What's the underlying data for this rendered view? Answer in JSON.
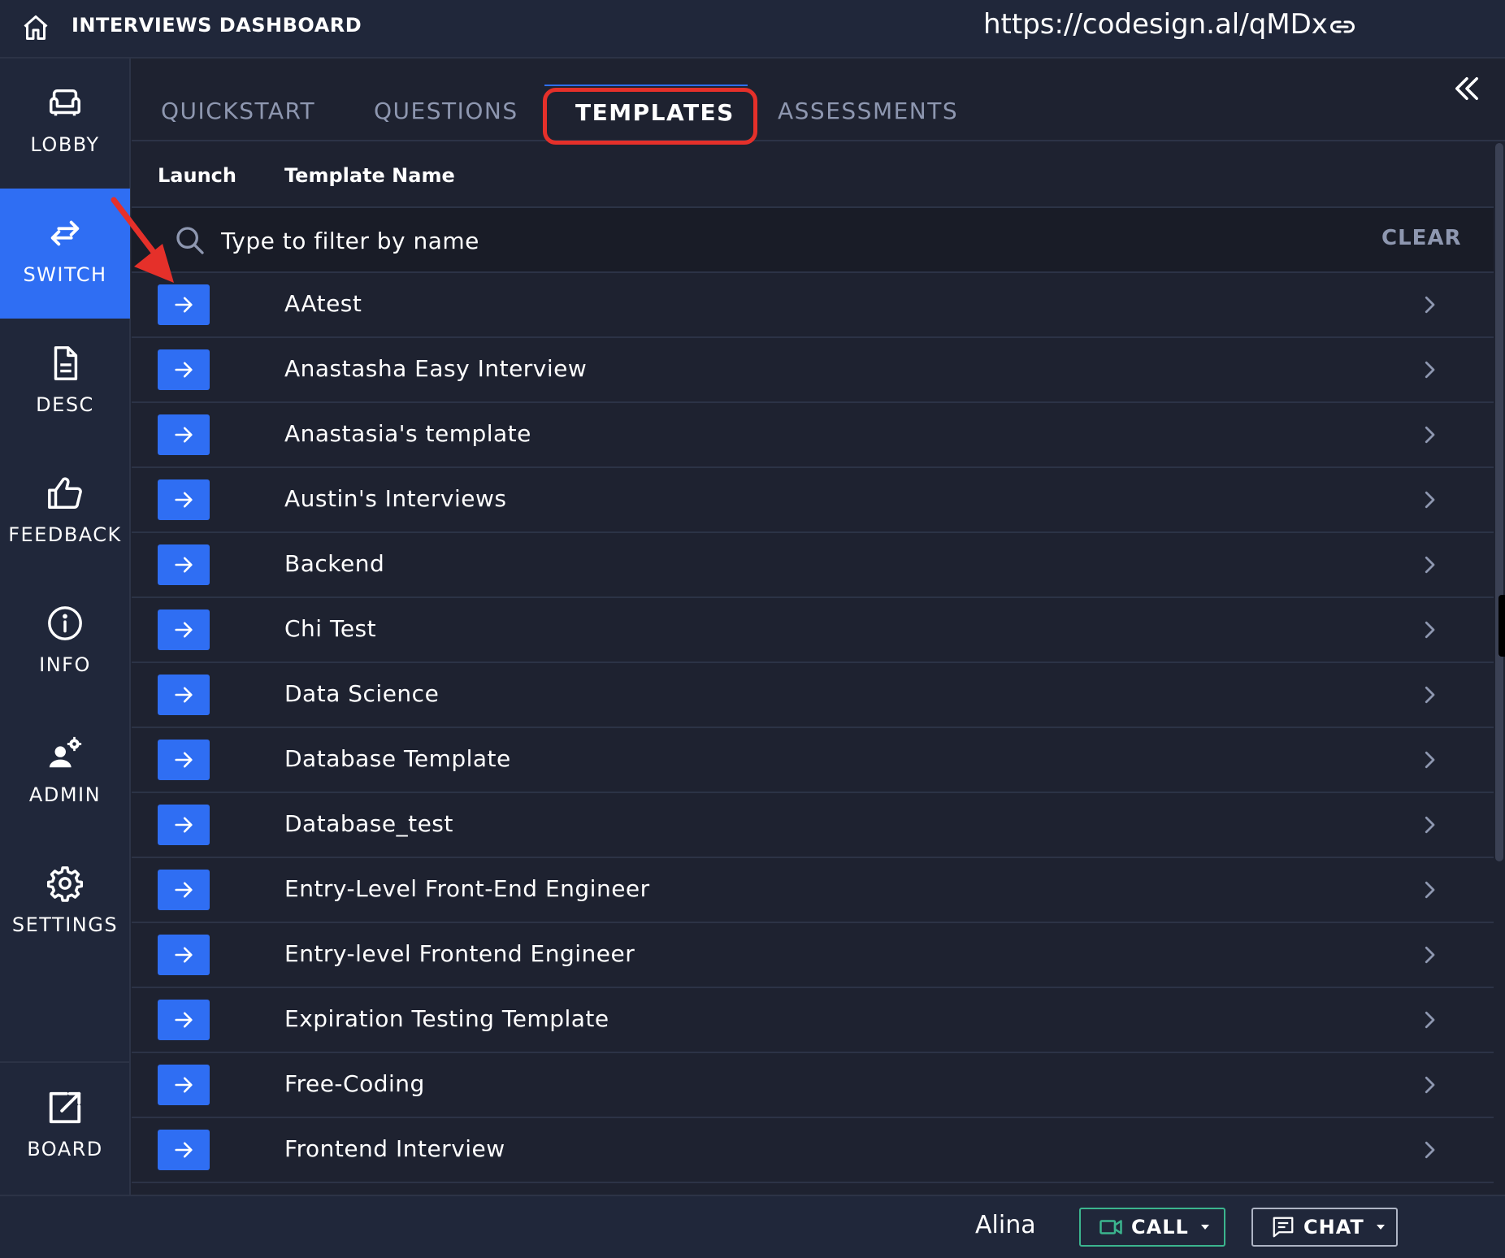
{
  "header": {
    "title": "INTERVIEWS DASHBOARD",
    "url": "https://codesign.al/qMDx"
  },
  "sidebar": {
    "items": [
      {
        "label": "LOBBY",
        "icon": "sofa-icon",
        "active": false
      },
      {
        "label": "SWITCH",
        "icon": "switch-arrows-icon",
        "active": true
      },
      {
        "label": "DESC",
        "icon": "document-icon",
        "active": false
      },
      {
        "label": "FEEDBACK",
        "icon": "thumbs-up-icon",
        "active": false
      },
      {
        "label": "INFO",
        "icon": "info-icon",
        "active": false
      },
      {
        "label": "ADMIN",
        "icon": "user-gear-icon",
        "active": false
      },
      {
        "label": "SETTINGS",
        "icon": "gear-icon",
        "active": false
      }
    ],
    "board": {
      "label": "BOARD",
      "icon": "external-link-icon"
    }
  },
  "tabs": [
    {
      "label": "QUICKSTART",
      "active": false
    },
    {
      "label": "QUESTIONS",
      "active": false
    },
    {
      "label": "TEMPLATES",
      "active": true
    },
    {
      "label": "ASSESSMENTS",
      "active": false
    }
  ],
  "table": {
    "headers": {
      "launch": "Launch",
      "name": "Template Name"
    },
    "filter_placeholder": "Type to filter by name",
    "clear_label": "CLEAR",
    "rows": [
      "AAtest",
      "Anastasha Easy Interview",
      "Anastasia's template",
      "Austin's Interviews",
      "Backend",
      "Chi Test",
      "Data Science",
      "Database Template",
      "Database_test",
      "Entry-Level Front-End Engineer",
      "Entry-level Frontend Engineer",
      "Expiration Testing Template",
      "Free-Coding",
      "Frontend Interview"
    ]
  },
  "footer": {
    "user": "Alina",
    "call_label": "CALL",
    "chat_label": "CHAT"
  },
  "colors": {
    "accent": "#2f6ef3",
    "annotation": "#e5302a",
    "call_border": "#3bb58e",
    "background": "#1e2230"
  }
}
